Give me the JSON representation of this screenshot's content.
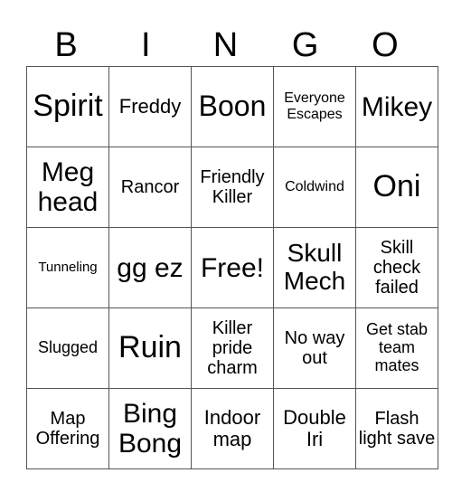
{
  "header": [
    "B",
    "I",
    "N",
    "G",
    "O"
  ],
  "cells": [
    [
      "Spirit",
      "Freddy",
      "Boon",
      "Everyone Escapes",
      "Mikey"
    ],
    [
      "Meg head",
      "Rancor",
      "Friendly Killer",
      "Coldwind",
      "Oni"
    ],
    [
      "Tunneling",
      "gg ez",
      "Free!",
      "Skull Mech",
      "Skill check failed"
    ],
    [
      "Slugged",
      "Ruin",
      "Killer pride charm",
      "No way out",
      "Get stab team mates"
    ],
    [
      "Map Offering",
      "Bing Bong",
      "Indoor map",
      "Double Iri",
      "Flash light save"
    ]
  ]
}
